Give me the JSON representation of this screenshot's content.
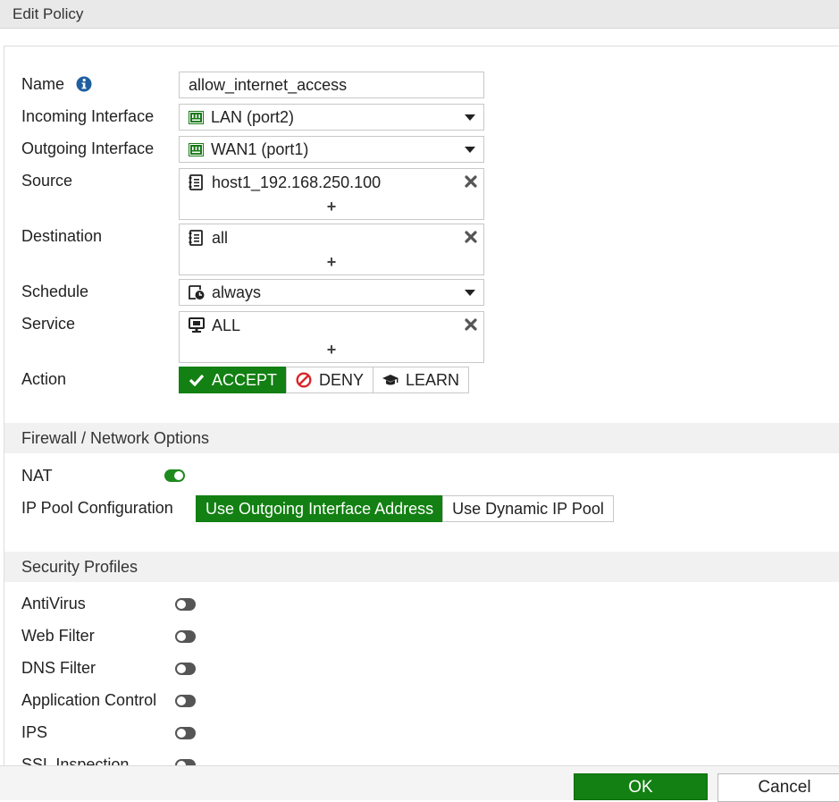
{
  "dialog": {
    "title": "Edit Policy"
  },
  "form": {
    "name": {
      "label": "Name",
      "value": "allow_internet_access"
    },
    "incoming": {
      "label": "Incoming Interface",
      "value": "LAN (port2)"
    },
    "outgoing": {
      "label": "Outgoing Interface",
      "value": "WAN1 (port1)"
    },
    "source": {
      "label": "Source",
      "value": "host1_192.168.250.100",
      "add": "+"
    },
    "destination": {
      "label": "Destination",
      "value": "all",
      "add": "+"
    },
    "schedule": {
      "label": "Schedule",
      "value": "always"
    },
    "service": {
      "label": "Service",
      "value": "ALL",
      "add": "+"
    },
    "action": {
      "label": "Action",
      "options": [
        "ACCEPT",
        "DENY",
        "LEARN"
      ],
      "selected": "ACCEPT"
    }
  },
  "firewall": {
    "title": "Firewall / Network Options",
    "nat": {
      "label": "NAT",
      "enabled": true
    },
    "ip_pool": {
      "label": "IP Pool Configuration",
      "options": [
        "Use Outgoing Interface Address",
        "Use Dynamic IP Pool"
      ],
      "selected": "Use Outgoing Interface Address"
    }
  },
  "security": {
    "title": "Security Profiles",
    "profiles": [
      {
        "label": "AntiVirus",
        "enabled": false
      },
      {
        "label": "Web Filter",
        "enabled": false
      },
      {
        "label": "DNS Filter",
        "enabled": false
      },
      {
        "label": "Application Control",
        "enabled": false
      },
      {
        "label": "IPS",
        "enabled": false
      },
      {
        "label": "SSL Inspection",
        "enabled": false
      }
    ]
  },
  "footer": {
    "ok": "OK",
    "cancel": "Cancel"
  },
  "colors": {
    "accent": "#128012",
    "toggle_off": "#555555",
    "info": "#1f5fa0"
  },
  "icons": {
    "name_info": "info-icon",
    "interface": "network-port-icon",
    "address": "address-object-icon",
    "schedule": "schedule-clock-icon",
    "service": "service-monitor-icon",
    "remove": "close-x-icon",
    "accept": "check-icon",
    "deny": "prohibited-icon",
    "learn": "graduation-cap-icon"
  }
}
